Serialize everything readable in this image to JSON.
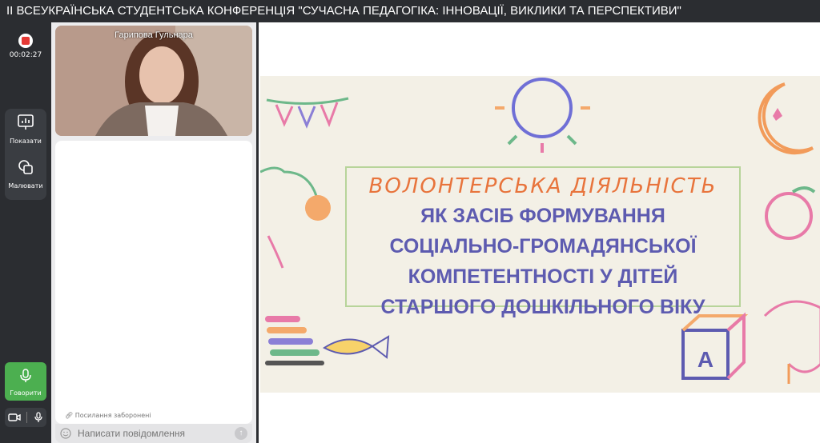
{
  "window": {
    "title": "ІІ ВСЕУКРАЇНСЬКА СТУДЕНТСЬКА КОНФЕРЕНЦІЯ \"СУЧАСНА ПЕДАГОГІКА: ІННОВАЦІЇ, ВИКЛИКИ ТА ПЕРСПЕКТИВИ\""
  },
  "recording": {
    "time": "00:02:27",
    "accent": "#e53935"
  },
  "tools": [
    {
      "label": "Показати",
      "icon": "presentation-icon"
    },
    {
      "label": "Малювати",
      "icon": "shapes-icon"
    }
  ],
  "speak": {
    "label": "Говорити",
    "icon": "microphone-icon",
    "color": "#4caf50"
  },
  "media": {
    "camera_icon": "camera-icon",
    "mic_icon": "microphone-icon"
  },
  "video": {
    "participant_name": "Гарипова Гульнара"
  },
  "chat": {
    "links_notice": "Посилання заборонені",
    "input_placeholder": "Написати повідомлення"
  },
  "slide": {
    "title_line1": "ВОЛОНТЕРСЬКА ДІЯЛЬНІСТЬ",
    "title_rest": [
      "ЯК ЗАСІБ ФОРМУВАННЯ",
      "СОЦІАЛЬНО-ГРОМАДЯНСЬКОЇ",
      "КОМПЕТЕНТНОСТІ У ДІТЕЙ",
      "СТАРШОГО ДОШКІЛЬНОГО ВІКУ"
    ],
    "block_letter": "A",
    "colors": {
      "orange": "#e8743c",
      "purple": "#5d5bb0",
      "green": "#b7d49a"
    }
  }
}
